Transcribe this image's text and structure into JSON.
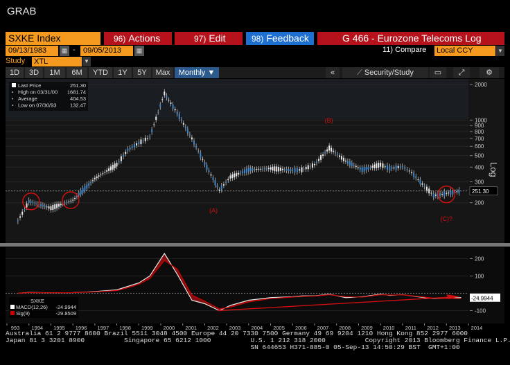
{
  "app": {
    "grab_label": "GRAB"
  },
  "header": {
    "security": "SXKE Index",
    "actions": {
      "num": "96)",
      "label": "Actions"
    },
    "edit": {
      "num": "97)",
      "label": "Edit"
    },
    "feedback": {
      "num": "98)",
      "label": "Feedback"
    },
    "title": "G 466 - Eurozone Telecoms Log",
    "compare": "11) Compare",
    "currency": "Local CCY",
    "start_date": "09/13/1983",
    "end_date": "09/05/2013",
    "date_separator": "-",
    "study_label": "Study",
    "study_value": "XTL"
  },
  "toolbar": {
    "ranges": [
      "1D",
      "3D",
      "1M",
      "6M",
      "YTD",
      "1Y",
      "5Y",
      "Max"
    ],
    "frequency": "Monthly ▼",
    "collapse": "«",
    "security_study": "Security/Study"
  },
  "legend": {
    "last_price": {
      "label": "Last Price",
      "value": "251.30"
    },
    "high": {
      "label": "High on 03/31/00",
      "value": "1681.74"
    },
    "average": {
      "label": "Average",
      "value": "404.53"
    },
    "low": {
      "label": "Low on 07/30/93",
      "value": "132.47"
    }
  },
  "price_axis": {
    "scale_label": "Log",
    "ticks": [
      "2000",
      "1000",
      "900",
      "800",
      "700",
      "600",
      "500",
      "400",
      "300",
      "200"
    ],
    "last_price_tag": "251.30"
  },
  "annotations": {
    "a": "(A)",
    "b": "(B)",
    "c": "(C)?"
  },
  "macd": {
    "title": "SXKE",
    "macd_label": "MACD(12,26)",
    "macd_value": "-24.9944",
    "sig_label": "Sig(9)",
    "sig_value": "-29.8509",
    "tag": "-24.9944",
    "ticks": [
      "200",
      "100",
      "-100"
    ]
  },
  "x_axis": [
    "993",
    "1994",
    "1995",
    "1996",
    "1997",
    "1998",
    "1999",
    "2000",
    "2001",
    "2002",
    "2003",
    "2004",
    "2005",
    "2006",
    "2007",
    "2008",
    "2009",
    "2010",
    "2011",
    "2012",
    "2013",
    "2014"
  ],
  "footer": {
    "line1": "Australia 61 2 9777 8600 Brazil 5511 3048 4500 Europe 44 20 7330 7500 Germany 49 69 9204 1210 Hong Kong 852 2977 6000",
    "line2": "Japan 81 3 3201 8900          Singapore 65 6212 1000          U.S. 1 212 318 2000          Copyright 2013 Bloomberg Finance L.P.",
    "line3": "                                                              SN 644653 H371-885-0 05-Sep-13 14:50:29 BST  GMT+1:00"
  },
  "colors": {
    "orange": "#f59a1e",
    "red": "#b5121b",
    "blue": "#1d6fd0",
    "price": "#3f86c8",
    "macd_red": "#cc0000",
    "annotation_red": "#d01010"
  },
  "chart_data": {
    "type": "line",
    "title": "Eurozone Telecoms Log",
    "x": [
      "1993-07",
      "1994-01",
      "1995-01",
      "1996-01",
      "1997-01",
      "1998-01",
      "1998-07",
      "1999-01",
      "1999-07",
      "2000-03",
      "2000-10",
      "2001-06",
      "2002-01",
      "2002-09",
      "2003-03",
      "2004-01",
      "2005-01",
      "2006-01",
      "2006-06",
      "2007-01",
      "2007-09",
      "2008-06",
      "2009-03",
      "2010-01",
      "2010-06",
      "2011-01",
      "2011-06",
      "2012-01",
      "2012-06",
      "2013-01",
      "2013-09"
    ],
    "series": [
      {
        "name": "Last Price",
        "values": [
          140,
          205,
          180,
          210,
          320,
          420,
          560,
          640,
          720,
          1681,
          1150,
          700,
          430,
          255,
          330,
          380,
          390,
          375,
          380,
          420,
          580,
          450,
          380,
          420,
          390,
          405,
          360,
          275,
          230,
          240,
          251.3
        ]
      },
      {
        "name": "MACD(12,26)",
        "values": [
          0,
          5,
          3,
          4,
          10,
          20,
          40,
          60,
          100,
          230,
          110,
          -40,
          -60,
          -100,
          -70,
          -40,
          -25,
          -20,
          -15,
          -15,
          -5,
          -25,
          -20,
          -5,
          -12,
          -8,
          -15,
          -25,
          -30,
          -28,
          -25
        ]
      },
      {
        "name": "Sig(9)",
        "values": [
          0,
          4,
          3,
          4,
          8,
          16,
          32,
          52,
          85,
          190,
          140,
          -10,
          -45,
          -90,
          -80,
          -50,
          -30,
          -22,
          -18,
          -16,
          -8,
          -20,
          -22,
          -8,
          -10,
          -9,
          -14,
          -22,
          -28,
          -29,
          -30
        ]
      }
    ],
    "scale": "log",
    "ylim": [
      100,
      2000
    ],
    "ylabel": "Log",
    "grid": true,
    "legend": "top-left"
  }
}
